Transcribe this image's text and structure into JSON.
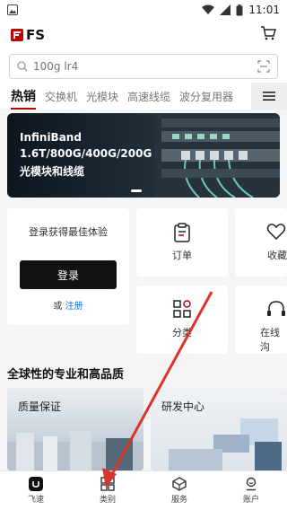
{
  "status": {
    "time": "11:01"
  },
  "header": {
    "brand": "FS"
  },
  "search": {
    "placeholder": "100g lr4"
  },
  "tabs": [
    {
      "label": "热销"
    },
    {
      "label": "交换机"
    },
    {
      "label": "光模块"
    },
    {
      "label": "高速线缆"
    },
    {
      "label": "波分复用器"
    }
  ],
  "banner": {
    "line1": "InfiniBand",
    "line2": "1.6T/800G/400G/200G",
    "line3": "光模块和线缆"
  },
  "login": {
    "hint": "登录获得最佳体验",
    "button": "登录",
    "or": "或",
    "register": "注册"
  },
  "tiles": {
    "orders": "订单",
    "favorites": "收藏",
    "categories": "分类",
    "online": "在线沟"
  },
  "section": {
    "title": "全球性的专业和高品质"
  },
  "features": [
    {
      "label": "质量保证"
    },
    {
      "label": "研发中心"
    }
  ],
  "bottom_nav": [
    {
      "label": "飞速",
      "icon": "home-icon"
    },
    {
      "label": "类别",
      "icon": "grid-icon"
    },
    {
      "label": "服务",
      "icon": "service-icon"
    },
    {
      "label": "账户",
      "icon": "account-icon"
    }
  ],
  "colors": {
    "brand_red": "#c00000",
    "link_blue": "#1a73e8",
    "annotation_arrow": "#d9342b"
  }
}
